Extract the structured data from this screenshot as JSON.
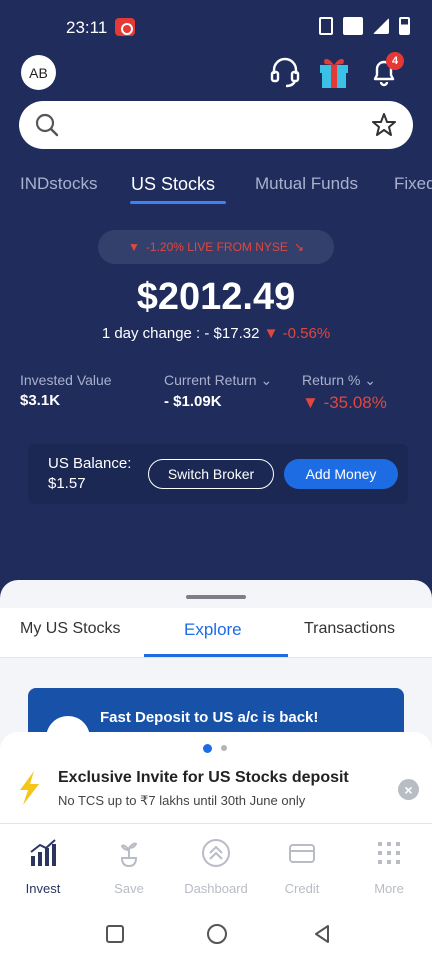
{
  "status_bar": {
    "time": "23:11"
  },
  "header": {
    "avatar_initials": "AB",
    "notification_count": "4",
    "icons": [
      "headset-icon",
      "gift-icon",
      "bell-icon"
    ]
  },
  "search": {
    "placeholder": "",
    "icons": [
      "search-icon",
      "star-icon"
    ]
  },
  "market_tabs": [
    {
      "label": "INDstocks"
    },
    {
      "label": "US Stocks",
      "active": true
    },
    {
      "label": "Mutual Funds"
    },
    {
      "label": "Fixed"
    }
  ],
  "portfolio": {
    "live_text": "-1.20% LIVE FROM NYSE",
    "total_value": "$2012.49",
    "day_change_prefix": "1 day change : - $17.32",
    "day_change_pct": "-0.56%",
    "invested_label": "Invested Value",
    "invested_value": "$3.1K",
    "current_return_label": "Current Return",
    "current_return_value": "- $1.09K",
    "return_pct_label": "Return %",
    "return_pct_value": "-35.08%"
  },
  "balance": {
    "label": "US Balance:",
    "value": "$1.57",
    "switch_broker_label": "Switch Broker",
    "add_money_label": "Add Money"
  },
  "sheet_tabs": [
    {
      "label": "My US Stocks"
    },
    {
      "label": "Explore",
      "active": true
    },
    {
      "label": "Transactions"
    }
  ],
  "promo": {
    "title": "Fast Deposit to US a/c is back!"
  },
  "invite": {
    "title": "Exclusive Invite for US Stocks deposit",
    "subtitle": "No TCS up to ₹7 lakhs until 30th June only"
  },
  "bottom_nav": [
    {
      "label": "Invest",
      "icon": "invest-chart-icon",
      "active": true
    },
    {
      "label": "Save",
      "icon": "save-plant-icon"
    },
    {
      "label": "Dashboard",
      "icon": "dashboard-icon"
    },
    {
      "label": "Credit",
      "icon": "credit-card-icon"
    },
    {
      "label": "More",
      "icon": "grid-dots-icon"
    }
  ],
  "colors": {
    "background": "#1f2c5c",
    "accent": "#1e6ce3",
    "negative": "#e0473f"
  }
}
